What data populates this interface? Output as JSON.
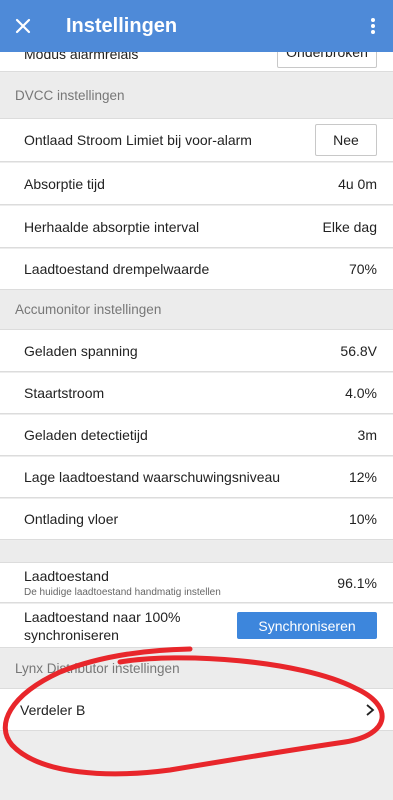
{
  "header": {
    "title": "Instellingen"
  },
  "alarm_row": {
    "label": "Modus alarmrelais",
    "value": "Onderbroken"
  },
  "dvcc": {
    "title": "DVCC instellingen",
    "rows": [
      {
        "label": "Ontlaad Stroom Limiet bij voor-alarm",
        "value": "Nee"
      },
      {
        "label": "Absorptie tijd",
        "value": "4u 0m"
      },
      {
        "label": "Herhaalde absorptie interval",
        "value": "Elke dag"
      },
      {
        "label": "Laadtoestand drempelwaarde",
        "value": "70%"
      }
    ]
  },
  "accumonitor": {
    "title": "Accumonitor instellingen",
    "rows": [
      {
        "label": "Geladen spanning",
        "value": "56.8V"
      },
      {
        "label": "Staartstroom",
        "value": "4.0%"
      },
      {
        "label": "Geladen detectietijd",
        "value": "3m"
      },
      {
        "label": "Lage laadtoestand waarschuwingsniveau",
        "value": "12%"
      },
      {
        "label": "Ontlading vloer",
        "value": "10%"
      }
    ]
  },
  "soc": {
    "label": "Laadtoestand",
    "sublabel": "De huidige laadtoestand handmatig instellen",
    "value": "96.1%"
  },
  "sync": {
    "label_line1": "Laadtoestand naar 100%",
    "label_line2": "synchroniseren",
    "button": "Synchroniseren"
  },
  "lynx": {
    "title": "Lynx Distributor instellingen",
    "item": "Verdeler B"
  },
  "colors": {
    "header": "#4e8ad8",
    "button": "#3d86dc",
    "annotation": "#e8262b"
  }
}
